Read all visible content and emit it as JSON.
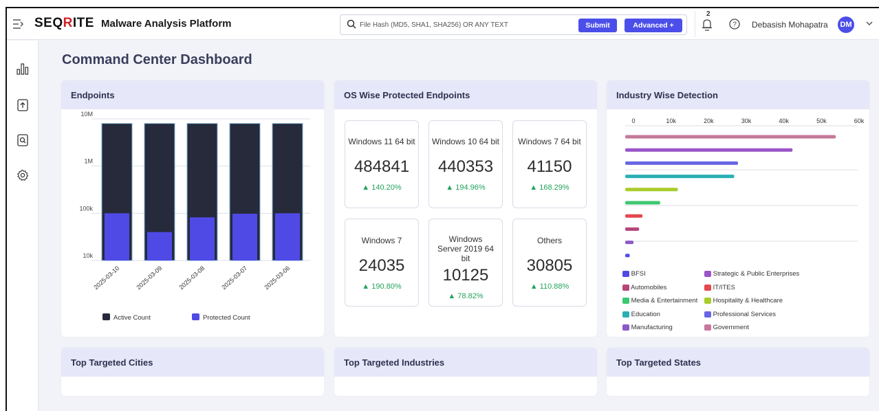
{
  "header": {
    "brand_part1": "SEQ",
    "brand_part2": "R",
    "brand_part3": "ITE",
    "app_title": "Malware Analysis Platform",
    "search_placeholder": "File Hash (MD5, SHA1, SHA256) OR ANY TEXT",
    "submit_label": "Submit",
    "advanced_label": "Advanced +",
    "notification_count": "2",
    "user_name": "Debasish Mohapatra",
    "avatar_initials": "DM"
  },
  "sidebar": {
    "icons": [
      "bar-chart-icon",
      "upload-file-icon",
      "search-document-icon",
      "settings-gear-icon"
    ]
  },
  "page": {
    "title": "Command Center Dashboard"
  },
  "cards": {
    "endpoints": "Endpoints",
    "os_wise": "OS Wise Protected Endpoints",
    "industry": "Industry Wise Detection",
    "cities": "Top Targeted Cities",
    "industries": "Top Targeted Industries",
    "states": "Top Targeted States"
  },
  "os_stats": [
    {
      "name": "Windows 11 64 bit",
      "value": "484841",
      "change": "140.20%"
    },
    {
      "name": "Windows 10 64 bit",
      "value": "440353",
      "change": "194.96%"
    },
    {
      "name": "Windows 7 64 bit",
      "value": "41150",
      "change": "168.29%"
    },
    {
      "name": "Windows 7",
      "value": "24035",
      "change": "190.80%"
    },
    {
      "name": "Windows Server 2019 64 bit",
      "value": "10125",
      "change": "78.82%"
    },
    {
      "name": "Others",
      "value": "30805",
      "change": "110.88%"
    }
  ],
  "colors": {
    "accent": "#4b4ee8",
    "active_bar": "#262a3b",
    "protected_bar": "#4f4ae6",
    "positive": "#21a35a"
  },
  "chart_data": [
    {
      "type": "bar",
      "scale": "log",
      "categories": [
        "2025-03-10",
        "2025-03-09",
        "2025-03-08",
        "2025-03-07",
        "2025-03-06"
      ],
      "y_ticks": [
        "10M",
        "1M",
        "100k",
        "10k"
      ],
      "ylim": [
        10000,
        10000000
      ],
      "series": [
        {
          "name": "Active Count",
          "color": "#262a3b",
          "values": [
            8000000,
            8000000,
            8000000,
            8000000,
            8000000
          ]
        },
        {
          "name": "Protected Count",
          "color": "#4f4ae6",
          "values": [
            100000,
            40000,
            82000,
            98000,
            100000
          ]
        }
      ],
      "legend": "bottom"
    },
    {
      "type": "bar",
      "orientation": "horizontal",
      "x_ticks": [
        "0",
        "10k",
        "20k",
        "30k",
        "40k",
        "50k",
        "60k"
      ],
      "xlim": [
        0,
        60000
      ],
      "values": [
        56000,
        44500,
        30000,
        29000,
        14000,
        9300,
        4600,
        3700,
        2200,
        1200
      ],
      "bar_colors": [
        "#c5799b",
        "#9a55c7",
        "#6966e6",
        "#2ab0b4",
        "#a8cc2a",
        "#3cc870",
        "#e5484d",
        "#b5457a",
        "#8c5ac8",
        "#4f4ae6"
      ],
      "legend": [
        {
          "label": "BFSI",
          "color": "#4f4ae6"
        },
        {
          "label": "Strategic & Public Enterprises",
          "color": "#9a55c7"
        },
        {
          "label": "Automobiles",
          "color": "#b5457a"
        },
        {
          "label": "IT/ITES",
          "color": "#e5484d"
        },
        {
          "label": "Media & Entertainment",
          "color": "#3cc870"
        },
        {
          "label": "Hospitality & Healthcare",
          "color": "#a8cc2a"
        },
        {
          "label": "Education",
          "color": "#2ab0b4"
        },
        {
          "label": "Professional Services",
          "color": "#6966e6"
        },
        {
          "label": "Manufacturing",
          "color": "#8c5ac8"
        },
        {
          "label": "Government",
          "color": "#c5799b"
        }
      ]
    }
  ]
}
